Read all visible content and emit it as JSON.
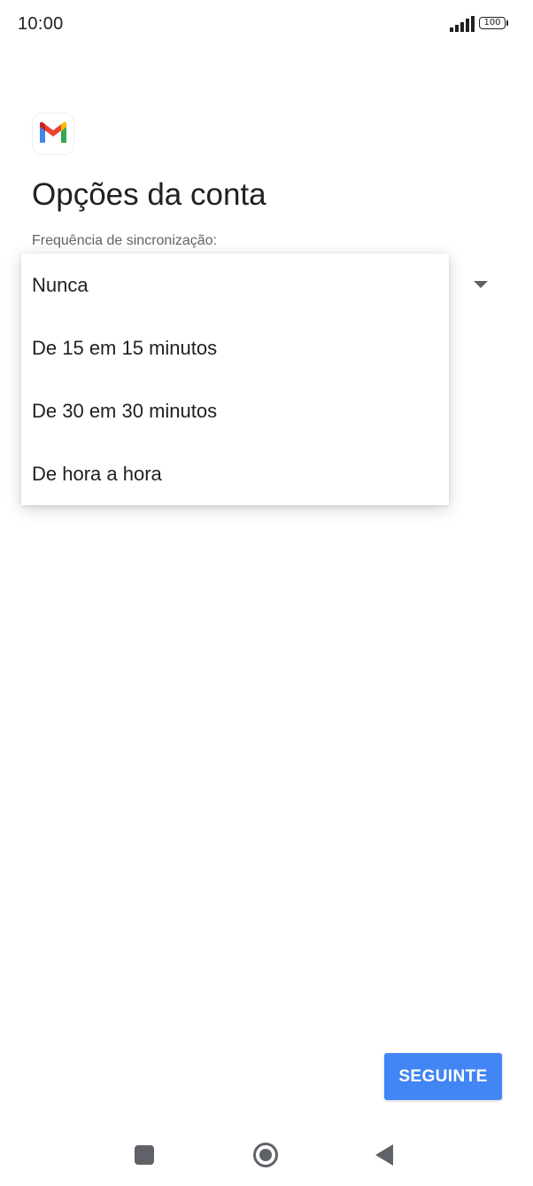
{
  "status_bar": {
    "time": "10:00",
    "battery_level": "100"
  },
  "app": {
    "icon": "gmail-icon"
  },
  "header": {
    "title": "Opções da conta"
  },
  "sync": {
    "label": "Frequência de sincronização:"
  },
  "dropdown": {
    "options": [
      "Nunca",
      "De 15 em 15 minutos",
      "De 30 em 30 minutos",
      "De hora a hora"
    ]
  },
  "footer": {
    "next_label": "SEGUINTE"
  },
  "colors": {
    "primary_button": "#4285f4",
    "gmail_red": "#ea4335",
    "gmail_blue": "#4285f4",
    "gmail_green": "#34a853",
    "gmail_yellow": "#fbbc04"
  }
}
